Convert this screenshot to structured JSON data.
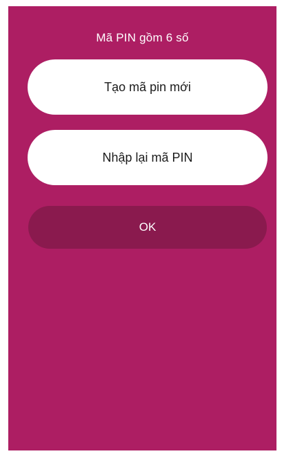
{
  "pin_form": {
    "hint": "Mã PIN gồm 6 số",
    "new_pin_placeholder": "Tạo mã pin mới",
    "confirm_pin_placeholder": "Nhập lại mã PIN",
    "ok_label": "OK"
  },
  "colors": {
    "background": "#ad1e63",
    "ok_button": "#8a1a4e",
    "field": "#ffffff"
  }
}
